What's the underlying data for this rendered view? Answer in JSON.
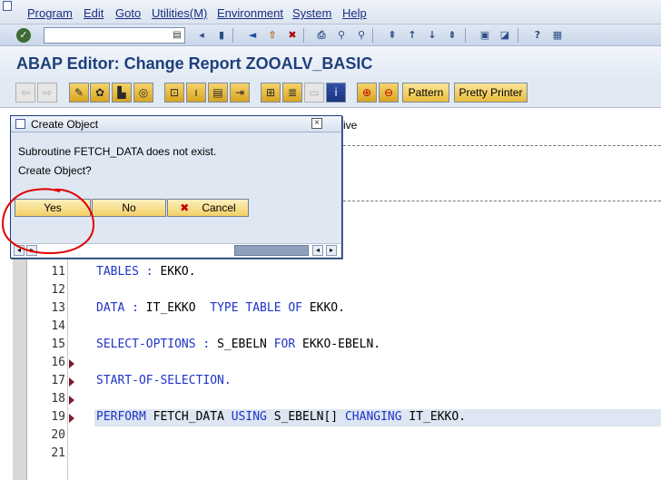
{
  "menu": [
    "Program",
    "Edit",
    "Goto",
    "Utilities(M)",
    "Environment",
    "System",
    "Help"
  ],
  "title": "ABAP Editor: Change Report ZOOALV_BASIC",
  "app_toolbar": {
    "pattern_label": "Pattern",
    "pretty_printer_label": "Pretty Printer"
  },
  "editor": {
    "tab_partial": "ive",
    "lines": [
      {
        "num": "11",
        "marker": false,
        "highlight": false,
        "segments": [
          {
            "t": "TABLES : ",
            "k": true
          },
          {
            "t": "EKKO.",
            "k": false
          }
        ]
      },
      {
        "num": "12",
        "marker": false,
        "highlight": false,
        "segments": []
      },
      {
        "num": "13",
        "marker": false,
        "highlight": false,
        "segments": [
          {
            "t": "DATA : ",
            "k": true
          },
          {
            "t": "IT_EKKO  ",
            "k": false
          },
          {
            "t": "TYPE TABLE OF ",
            "k": true
          },
          {
            "t": "EKKO.",
            "k": false
          }
        ]
      },
      {
        "num": "14",
        "marker": false,
        "highlight": false,
        "segments": []
      },
      {
        "num": "15",
        "marker": false,
        "highlight": false,
        "segments": [
          {
            "t": "SELECT-OPTIONS : ",
            "k": true
          },
          {
            "t": "S_EBELN ",
            "k": false
          },
          {
            "t": "FOR ",
            "k": true
          },
          {
            "t": "EKKO-EBELN.",
            "k": false
          }
        ]
      },
      {
        "num": "16",
        "marker": true,
        "highlight": false,
        "segments": []
      },
      {
        "num": "17",
        "marker": true,
        "highlight": false,
        "segments": [
          {
            "t": "START-OF-SELECTION.",
            "k": true
          }
        ]
      },
      {
        "num": "18",
        "marker": true,
        "highlight": false,
        "segments": []
      },
      {
        "num": "19",
        "marker": true,
        "highlight": true,
        "segments": [
          {
            "t": "PERFORM ",
            "k": true
          },
          {
            "t": "FETCH_DATA ",
            "k": false
          },
          {
            "t": "USING ",
            "k": true
          },
          {
            "t": "S_EBELN[] ",
            "k": false
          },
          {
            "t": "CHANGING ",
            "k": true
          },
          {
            "t": "IT_EKKO.",
            "k": false
          }
        ]
      },
      {
        "num": "20",
        "marker": false,
        "highlight": false,
        "segments": []
      },
      {
        "num": "21",
        "marker": false,
        "highlight": false,
        "segments": []
      }
    ]
  },
  "dialog": {
    "title": "Create Object",
    "message_line1": "Subroutine FETCH_DATA does not exist.",
    "message_line2": "Create Object?",
    "yes_label": "Yes",
    "no_label": "No",
    "cancel_label": "Cancel"
  },
  "icons": {
    "menu": "sap-window-icon",
    "toolbar": [
      "enter-check-icon",
      "back-icon",
      "exit-icon",
      "cancel-icon",
      "print-icon",
      "find-icon",
      "find-next-icon",
      "first-page-icon",
      "prev-page-icon",
      "next-page-icon",
      "last-page-icon",
      "new-session-icon",
      "shortcut-icon",
      "help-icon",
      "customize-layout-icon"
    ],
    "app_toolbar": [
      "back-nav-icon",
      "forward-nav-icon",
      "display-change-icon",
      "other-object-icon",
      "check-icon",
      "activate-icon",
      "test-icon",
      "where-used-icon",
      "object-list-icon",
      "navigation-window-icon",
      "display-object-list-icon",
      "enhance-icon",
      "fullscreen-icon",
      "information-icon",
      "insert-stmt-icon",
      "delete-icon"
    ]
  }
}
